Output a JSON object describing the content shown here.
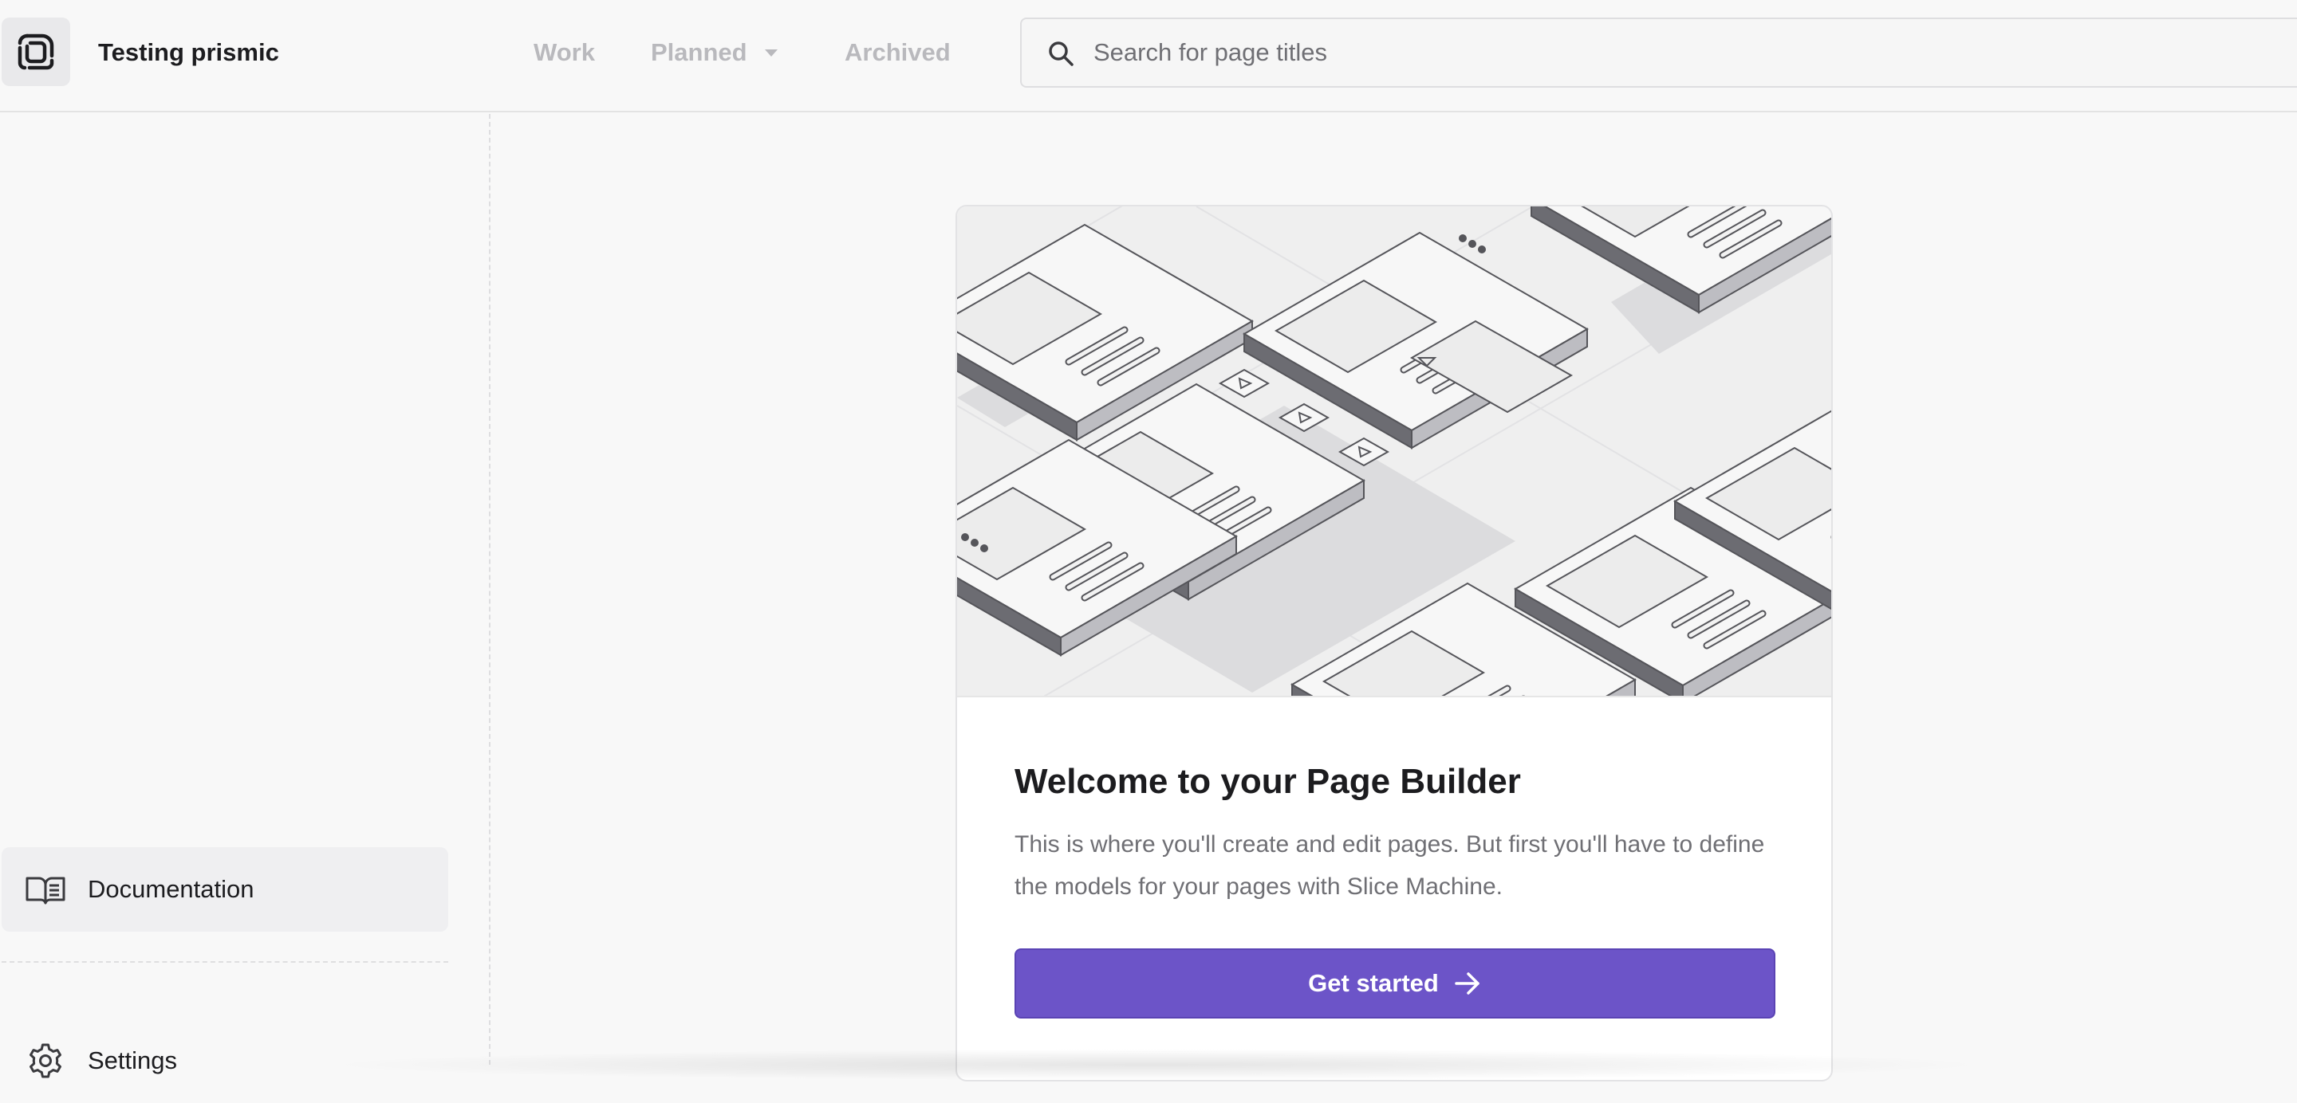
{
  "header": {
    "repo_name": "Testing prismic",
    "tabs": [
      {
        "label": "Work"
      },
      {
        "label": "Planned"
      },
      {
        "label": "Archived"
      }
    ],
    "search": {
      "placeholder": "Search for page titles",
      "value": ""
    }
  },
  "sidebar": {
    "items": [
      {
        "label": "Documentation",
        "icon": "book-open-icon"
      },
      {
        "label": "Settings",
        "icon": "gear-icon"
      }
    ]
  },
  "welcome": {
    "title": "Welcome to your Page Builder",
    "body": "This is where you'll create and edit pages. But first you'll have to define the models for your pages with Slice Machine.",
    "cta_label": "Get started"
  },
  "colors": {
    "accent": "#6c54c8",
    "text": "#1c1c1f",
    "muted_text": "#6f6f74",
    "inactive_tab": "#b9b9bd",
    "background": "#f8f8f8"
  }
}
